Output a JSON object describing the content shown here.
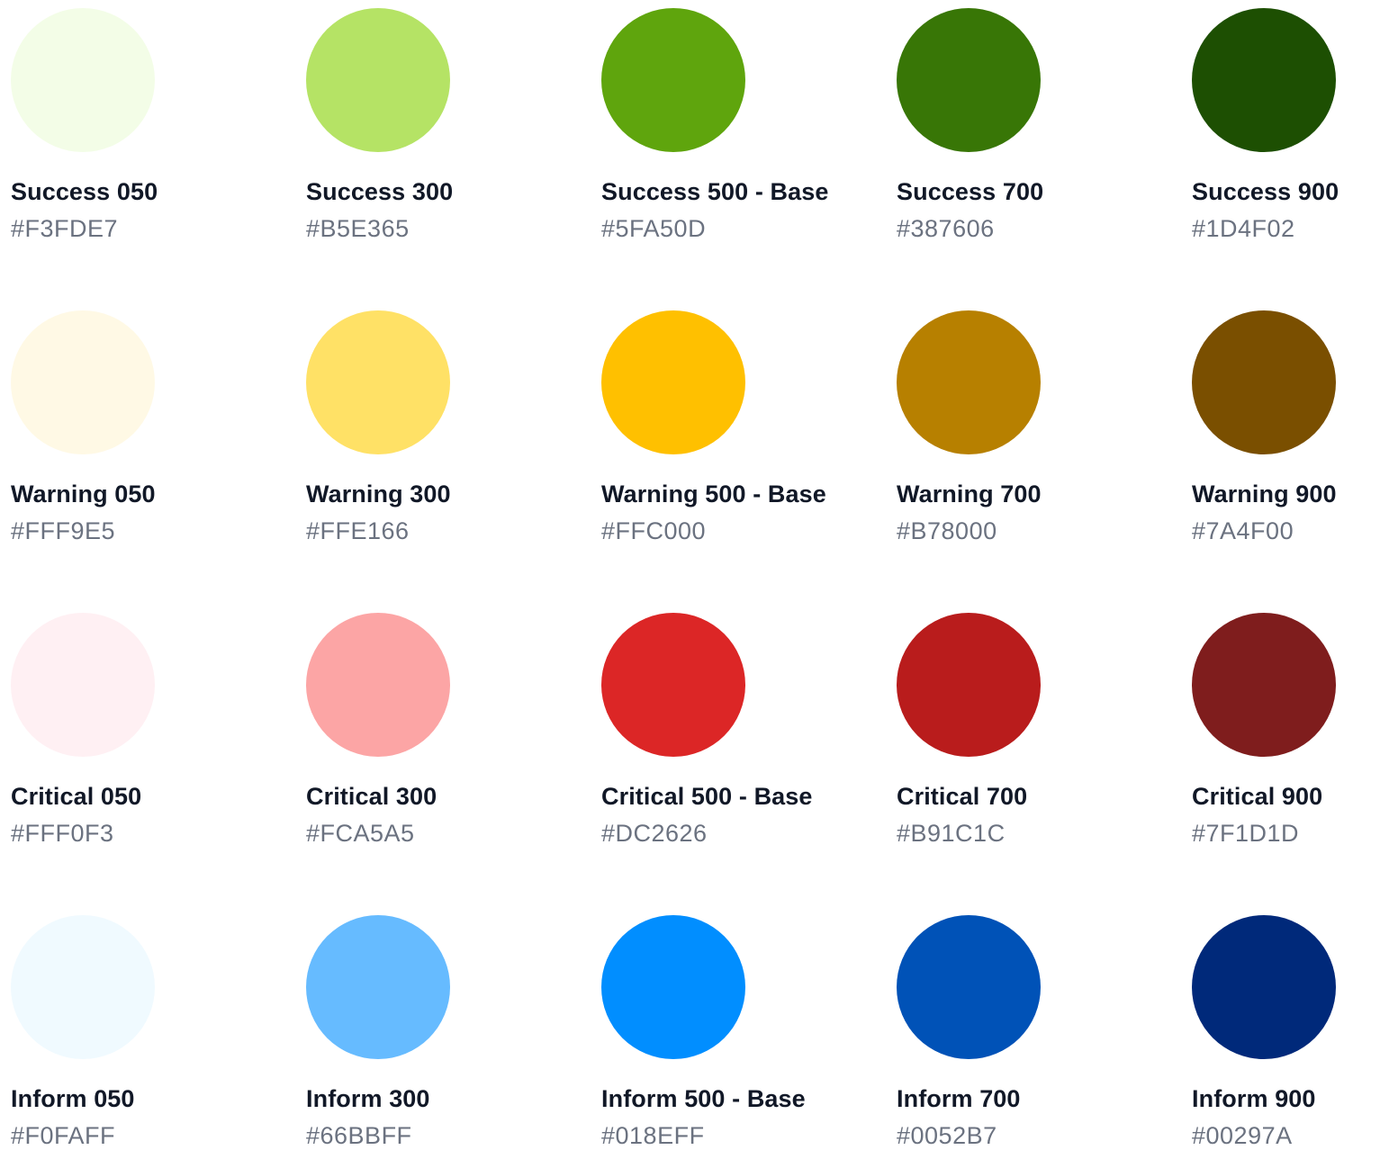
{
  "palette": {
    "rows": [
      {
        "group": "success",
        "swatches": [
          {
            "name": "Success 050",
            "hex": "#F3FDE7",
            "color": "#F3FDE7"
          },
          {
            "name": "Success 300",
            "hex": "#B5E365",
            "color": "#B5E365"
          },
          {
            "name": "Success 500 - Base",
            "hex": "#5FA50D",
            "color": "#5FA50D"
          },
          {
            "name": "Success 700",
            "hex": "#387606",
            "color": "#387606"
          },
          {
            "name": "Success 900",
            "hex": "#1D4F02",
            "color": "#1D4F02"
          }
        ]
      },
      {
        "group": "warning",
        "swatches": [
          {
            "name": "Warning 050",
            "hex": "#FFF9E5",
            "color": "#FFF9E5"
          },
          {
            "name": "Warning 300",
            "hex": "#FFE166",
            "color": "#FFE166"
          },
          {
            "name": "Warning 500 - Base",
            "hex": "#FFC000",
            "color": "#FFC000"
          },
          {
            "name": "Warning 700",
            "hex": "#B78000",
            "color": "#B78000"
          },
          {
            "name": "Warning 900",
            "hex": "#7A4F00",
            "color": "#7A4F00"
          }
        ]
      },
      {
        "group": "critical",
        "swatches": [
          {
            "name": "Critical 050",
            "hex": "#FFF0F3",
            "color": "#FFF0F3"
          },
          {
            "name": "Critical 300",
            "hex": "#FCA5A5",
            "color": "#FCA5A5"
          },
          {
            "name": "Critical 500 - Base",
            "hex": "#DC2626",
            "color": "#DC2626"
          },
          {
            "name": "Critical 700",
            "hex": "#B91C1C",
            "color": "#B91C1C"
          },
          {
            "name": "Critical 900",
            "hex": "#7F1D1D",
            "color": "#7F1D1D"
          }
        ]
      },
      {
        "group": "inform",
        "swatches": [
          {
            "name": "Inform 050",
            "hex": "#F0FAFF",
            "color": "#F0FAFF"
          },
          {
            "name": "Inform 300",
            "hex": "#66BBFF",
            "color": "#66BBFF"
          },
          {
            "name": "Inform 500 - Base",
            "hex": "#018EFF",
            "color": "#018EFF"
          },
          {
            "name": "Inform 700",
            "hex": "#0052B7",
            "color": "#0052B7"
          },
          {
            "name": "Inform 900",
            "hex": "#00297A",
            "color": "#00297A"
          }
        ]
      }
    ]
  }
}
